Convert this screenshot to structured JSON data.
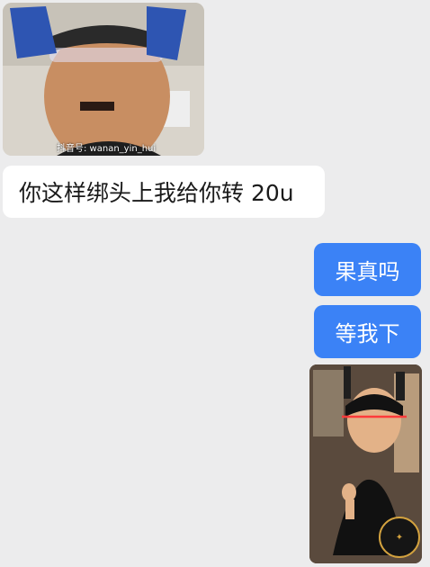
{
  "messages": [
    {
      "type": "image",
      "side": "incoming",
      "watermark": "抖音号: wanan_yin_hui"
    },
    {
      "type": "text",
      "side": "incoming",
      "text": "你这样绑头上我给你转 20u"
    },
    {
      "type": "text",
      "side": "outgoing",
      "text": "果真吗"
    },
    {
      "type": "text",
      "side": "outgoing",
      "text": "等我下"
    },
    {
      "type": "image",
      "side": "outgoing"
    }
  ],
  "theme": {
    "background": "#ececed",
    "incoming_bubble": "#ffffff",
    "outgoing_bubble": "#3b82f6"
  }
}
